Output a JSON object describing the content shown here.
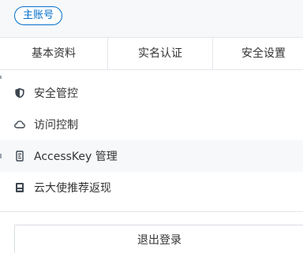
{
  "account": {
    "badge_label": "主账号"
  },
  "tabs": [
    {
      "label": "基本资料"
    },
    {
      "label": "实名认证"
    },
    {
      "label": "安全设置"
    }
  ],
  "menu": [
    {
      "label": "安全管控",
      "icon": "shield-icon"
    },
    {
      "label": "访问控制",
      "icon": "cloud-icon"
    },
    {
      "label": "AccessKey 管理",
      "icon": "key-icon"
    },
    {
      "label": "云大使推荐返现",
      "icon": "recommend-icon"
    }
  ],
  "logout": {
    "label": "退出登录"
  },
  "colors": {
    "accent": "#0070cc",
    "icon": "#3d4650",
    "hover_bg": "#f7f8fa",
    "border": "#e4e7ec"
  }
}
